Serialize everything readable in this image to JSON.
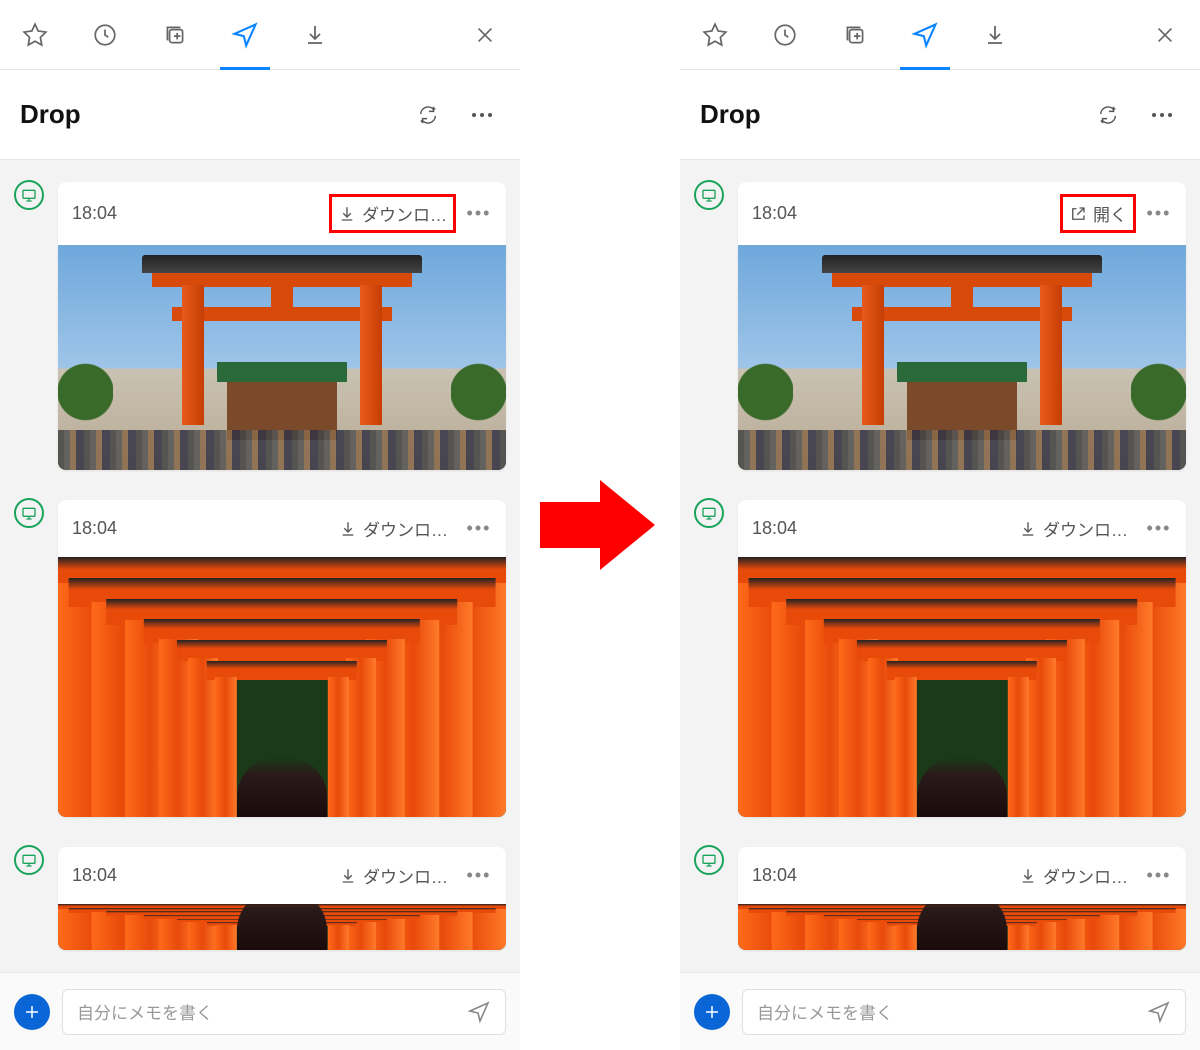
{
  "header": {
    "title": "Drop"
  },
  "composer": {
    "placeholder": "自分にメモを書く"
  },
  "left": {
    "messages": [
      {
        "time": "18:04",
        "action": "ダウンロ…",
        "action_kind": "download",
        "highlight": true,
        "thumb": "torii_gate",
        "thumb_h": "normal"
      },
      {
        "time": "18:04",
        "action": "ダウンロ…",
        "action_kind": "download",
        "highlight": false,
        "thumb": "torii_tunnel",
        "thumb_h": "tall"
      },
      {
        "time": "18:04",
        "action": "ダウンロ…",
        "action_kind": "download",
        "highlight": false,
        "thumb": "torii_tunnel",
        "thumb_h": "clipped"
      }
    ]
  },
  "right": {
    "messages": [
      {
        "time": "18:04",
        "action": "開く",
        "action_kind": "open",
        "highlight": true,
        "thumb": "torii_gate",
        "thumb_h": "normal"
      },
      {
        "time": "18:04",
        "action": "ダウンロ…",
        "action_kind": "download",
        "highlight": false,
        "thumb": "torii_tunnel",
        "thumb_h": "tall"
      },
      {
        "time": "18:04",
        "action": "ダウンロ…",
        "action_kind": "download",
        "highlight": false,
        "thumb": "torii_tunnel",
        "thumb_h": "clipped"
      }
    ]
  }
}
